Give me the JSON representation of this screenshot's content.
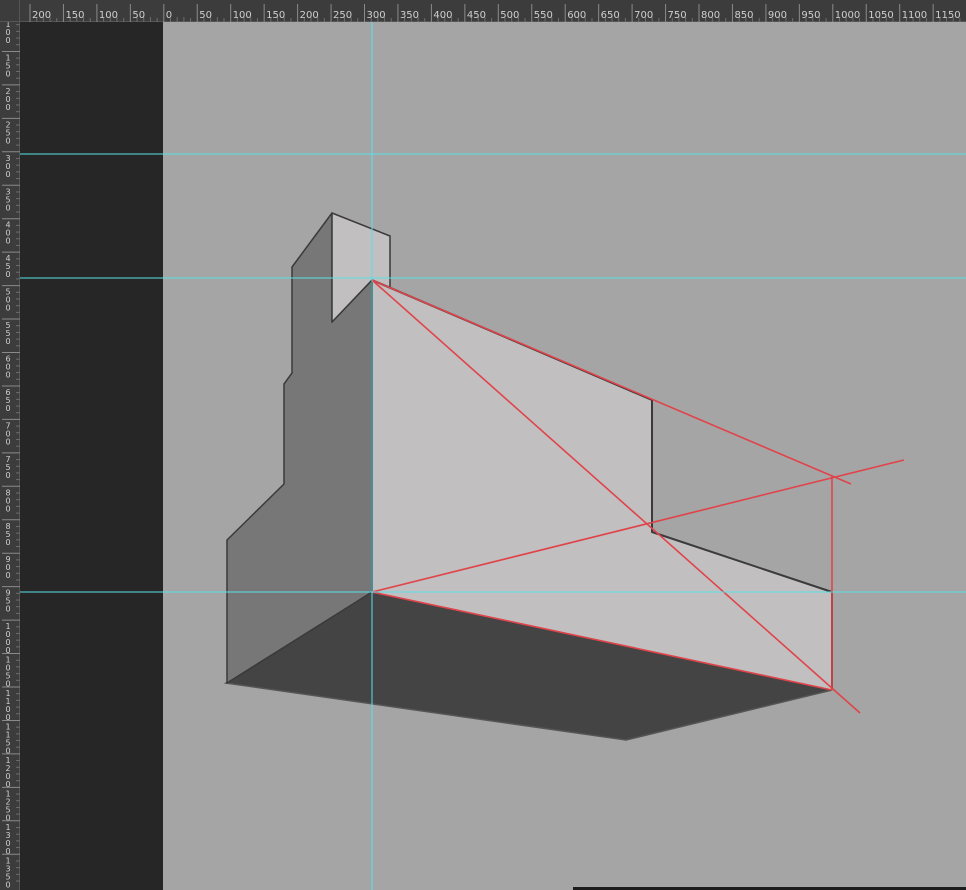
{
  "rulers": {
    "horizontal_labels": [
      "200",
      "150",
      "100",
      "50",
      "0",
      "50",
      "100",
      "150",
      "200",
      "250",
      "300",
      "350",
      "400",
      "450",
      "500",
      "550",
      "600",
      "650",
      "700",
      "750",
      "800",
      "850",
      "900",
      "950",
      "1000",
      "1050",
      "1100",
      "1150"
    ],
    "vertical_labels": [
      "100",
      "150",
      "200",
      "250",
      "300",
      "350",
      "400",
      "450",
      "500",
      "550",
      "600",
      "650",
      "700",
      "750",
      "800",
      "850",
      "900",
      "950",
      "1000",
      "1050",
      "1100",
      "1150",
      "1200",
      "1250",
      "1300",
      "1350"
    ]
  },
  "guides": {
    "color": "#58e1e8",
    "horizontal_count": 3,
    "vertical_count": 1
  },
  "colors": {
    "pasteboard": "#262626",
    "canvas": "#a6a5a6",
    "ruler_bg": "#3c3c3c",
    "ruler_text": "#cfcfcf",
    "perspective_lines": "#e0444a",
    "face_light": "#c2bfc1",
    "face_mid": "#777777",
    "face_dark": "#444444",
    "edge": "#3a3a3a"
  }
}
